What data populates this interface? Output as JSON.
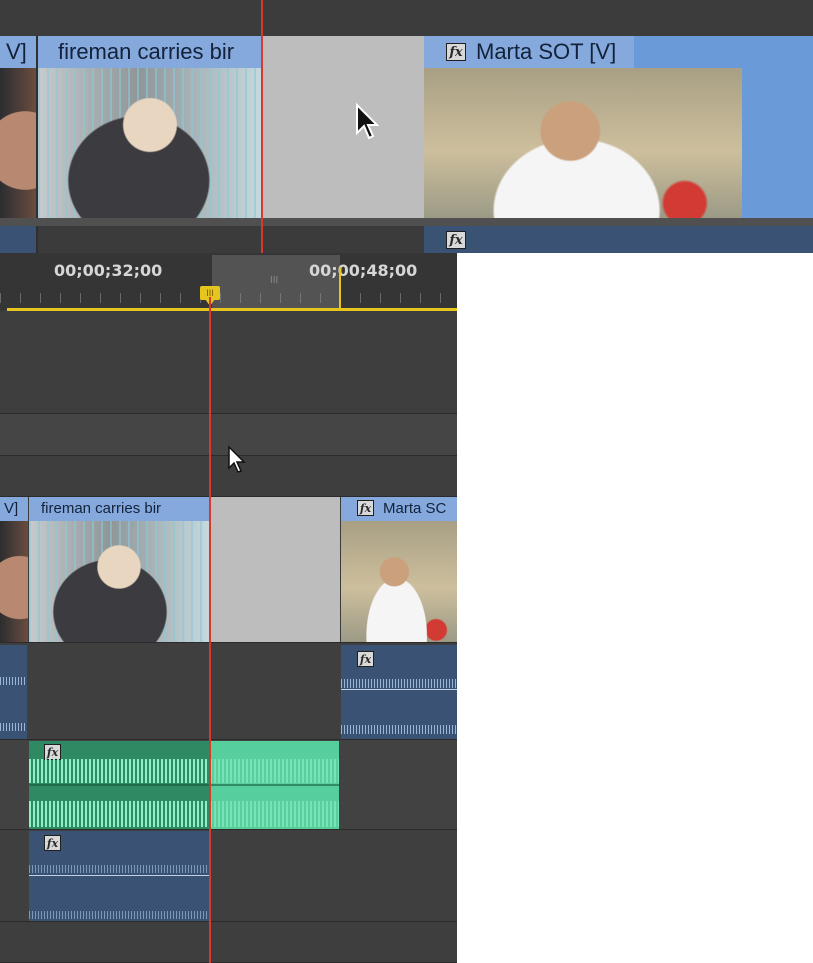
{
  "top_zoom": {
    "clip_left_label": "V]",
    "clip_main_label": "fireman carries bir",
    "clip_right_label": "Marta SOT [V]",
    "fx_label": "fx",
    "audio_fx_label": "fx"
  },
  "timeline": {
    "timecodes": [
      "00;00;32;00",
      "00;00;48;00"
    ],
    "playhead_marker": "III",
    "work_area_mark": "III",
    "video_clips": {
      "left_label": "V]",
      "main_label": "fireman carries bir",
      "right_label": "Marta SC",
      "fx_label": "fx"
    },
    "audio_fx_label": "fx"
  },
  "colors": {
    "video_clip": "#85a9dc",
    "audio_clip": "#3a5274",
    "selected_audio": "#56cf9d",
    "playhead": "#d9392b",
    "work_area_bar": "#e7c51f"
  }
}
